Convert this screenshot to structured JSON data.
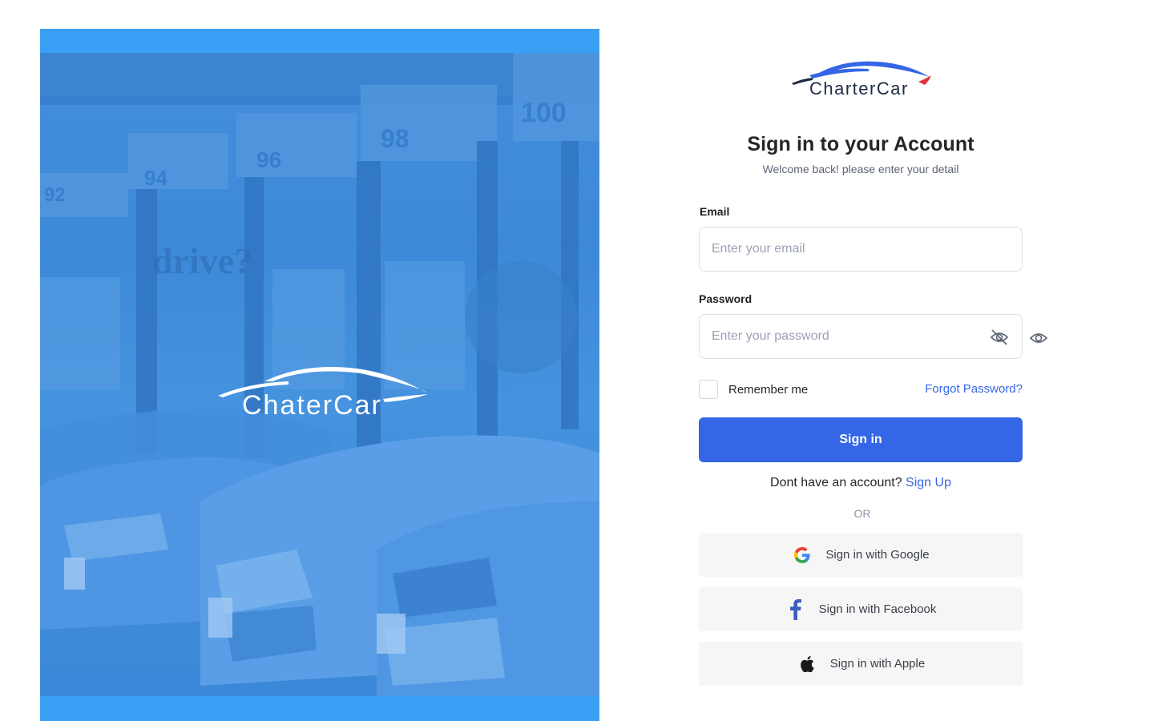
{
  "hero": {
    "brand_name": "ChaterCar",
    "photo_signs": [
      "92",
      "94",
      "96",
      "98",
      "100",
      "drive?"
    ]
  },
  "brand": {
    "name": "CharterCar"
  },
  "header": {
    "title": "Sign in to your Account",
    "subtitle": "Welcome back! please enter your detail"
  },
  "form": {
    "email_label": "Email",
    "email_placeholder": "Enter your email",
    "password_label": "Password",
    "password_placeholder": "Enter your password",
    "remember_label": "Remember me",
    "forgot_label": "Forgot Password?",
    "signin_label": "Sign in"
  },
  "signup": {
    "prompt": "Dont have an account? ",
    "link": "Sign Up"
  },
  "divider": "OR",
  "social": {
    "google": "Sign in with Google",
    "facebook": "Sign in with Facebook",
    "apple": "Sign in with Apple"
  },
  "colors": {
    "primary": "#3566e6",
    "hero": "#3aa0f5",
    "logo_accent": "#e0323a"
  },
  "icons": [
    "google-icon",
    "facebook-icon",
    "apple-icon",
    "eye-off-icon",
    "eye-icon"
  ]
}
